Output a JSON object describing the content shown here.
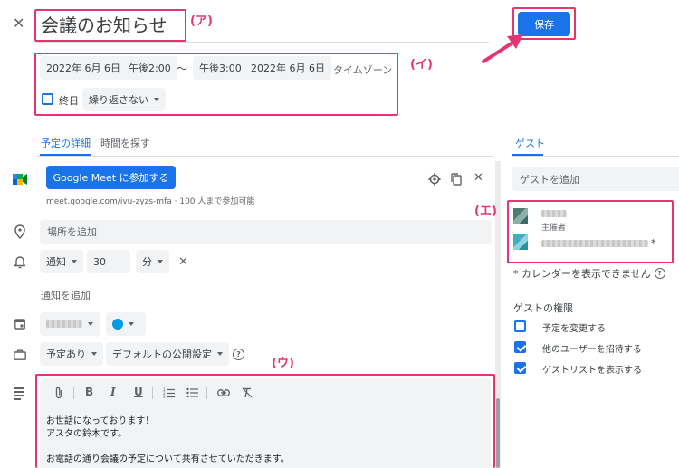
{
  "header": {
    "close_glyph": "✕",
    "title": "会議のお知らせ",
    "save_label": "保存"
  },
  "annotations": {
    "a": "(ア)",
    "i": "(イ)",
    "u": "(ウ)",
    "e": "(エ)"
  },
  "datetime": {
    "start_date": "2022年 6月 6日",
    "start_time": "午後2:00",
    "separator": "〜",
    "end_time": "午後3:00",
    "end_date": "2022年 6月 6日",
    "timezone": "タイムゾーン",
    "all_day_label": "終日",
    "repeat_label": "繰り返さない"
  },
  "tabs": {
    "details": "予定の詳細",
    "find_time": "時間を探す",
    "guests": "ゲスト"
  },
  "meet": {
    "button_label": "Google Meet に参加する",
    "link_text": "meet.google.com/ivu-zyzs-mfa · 100 人まで参加可能"
  },
  "location": {
    "placeholder": "場所を追加"
  },
  "notification": {
    "type": "通知",
    "value": "30",
    "unit": "分",
    "clear_glyph": "✕",
    "add_label": "通知を追加"
  },
  "calendar": {
    "color": "#039be5"
  },
  "availability": {
    "busy_label": "予定あり",
    "visibility_label": "デフォルトの公開設定",
    "help_glyph": "?"
  },
  "description": {
    "toolbar": {
      "bold": "B",
      "italic": "I",
      "underline": "U"
    },
    "lines": [
      "お世話になっております！",
      "アスタの鈴木です。",
      "",
      "お電話の通り会議の予定について共有させていただきます。"
    ]
  },
  "guests": {
    "add_placeholder": "ゲストを追加",
    "organizer_label": "主催者",
    "asterisk": "*",
    "warning": "* カレンダーを表示できません",
    "permissions_title": "ゲストの権限",
    "permissions": [
      {
        "label": "予定を変更する",
        "checked": false
      },
      {
        "label": "他のユーザーを招待する",
        "checked": true
      },
      {
        "label": "ゲストリストを表示する",
        "checked": true
      }
    ]
  },
  "colors": {
    "accent": "#1a73e8",
    "annotation": "#e8336f"
  }
}
